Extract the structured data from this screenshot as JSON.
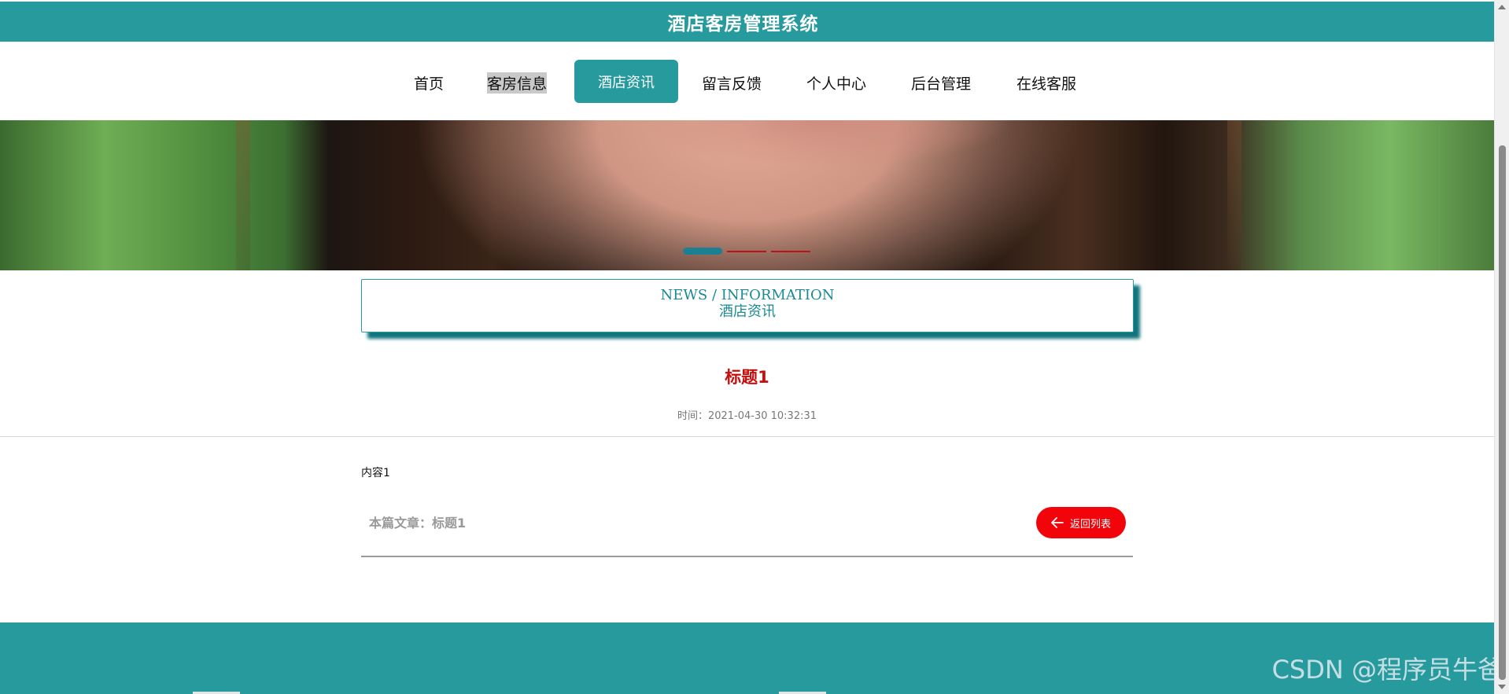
{
  "header": {
    "title": "酒店客房管理系统"
  },
  "nav": {
    "items": [
      {
        "label": "首页"
      },
      {
        "label": "客房信息"
      },
      {
        "label": "酒店资讯",
        "active": true
      },
      {
        "label": "留言反馈"
      },
      {
        "label": "个人中心"
      },
      {
        "label": "后台管理"
      },
      {
        "label": "在线客服"
      }
    ]
  },
  "banner": {
    "slides": 3,
    "active_slide": 1
  },
  "section": {
    "title_en": "NEWS / INFORMATION",
    "title_cn": "酒店资讯"
  },
  "article": {
    "title": "标题1",
    "time": "时间：2021-04-30 10:32:31",
    "content": "内容1",
    "this_article": "本篇文章：标题1",
    "back_label": "返回列表"
  },
  "watermark": "CSDN @程序员牛爸",
  "colors": {
    "primary": "#279a9e",
    "accent_red": "#f1050a",
    "title_red": "#c60c0c"
  }
}
